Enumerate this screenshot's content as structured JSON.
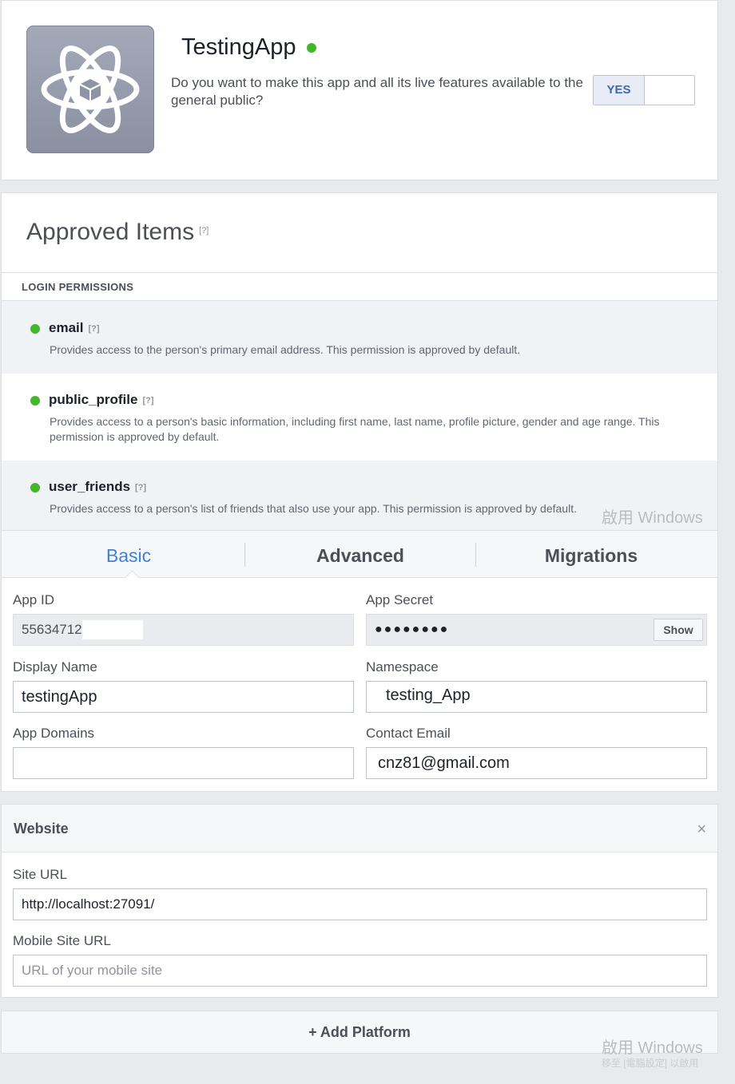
{
  "header": {
    "app_name": "TestingApp",
    "live_question": "Do you want to make this app and all its live features available to the general public?",
    "toggle_label": "YES",
    "app_icon": "atom-icon"
  },
  "approved": {
    "title": "Approved Items",
    "help": "[?]",
    "section_label": "LOGIN PERMISSIONS",
    "items": [
      {
        "name": "email",
        "help": "[?]",
        "description": "Provides access to the person's primary email address. This permission is approved by default."
      },
      {
        "name": "public_profile",
        "help": "[?]",
        "description": "Provides access to a person's basic information, including first name, last name, profile picture, gender and age range. This permission is approved by default."
      },
      {
        "name": "user_friends",
        "help": "[?]",
        "description": "Provides access to a person's list of friends that also use your app. This permission is approved by default."
      }
    ]
  },
  "tabs": [
    {
      "label": "Basic"
    },
    {
      "label": "Advanced"
    },
    {
      "label": "Migrations"
    }
  ],
  "basic": {
    "app_id_label": "App ID",
    "app_id_value": "55634712",
    "app_secret_label": "App Secret",
    "app_secret_value": "●●●●●●●●",
    "show_label": "Show",
    "display_name_label": "Display Name",
    "display_name_value": "testingApp",
    "namespace_label": "Namespace",
    "namespace_value": "testing_App",
    "app_domains_label": "App Domains",
    "app_domains_value": "",
    "contact_email_label": "Contact Email",
    "contact_email_value": "cnz81@gmail.com"
  },
  "website": {
    "title": "Website",
    "close": "×",
    "site_url_label": "Site URL",
    "site_url_value": "http://localhost:27091/",
    "mobile_url_label": "Mobile Site URL",
    "mobile_url_placeholder": "URL of your mobile site"
  },
  "add_platform": "+ Add Platform",
  "watermark": {
    "line1": "啟用 Windows",
    "line2": "移至 [電腦設定] 以啟用"
  },
  "colors": {
    "accent": "#4080d8",
    "live_green": "#42b72a",
    "page_bg": "#e9eaed"
  }
}
